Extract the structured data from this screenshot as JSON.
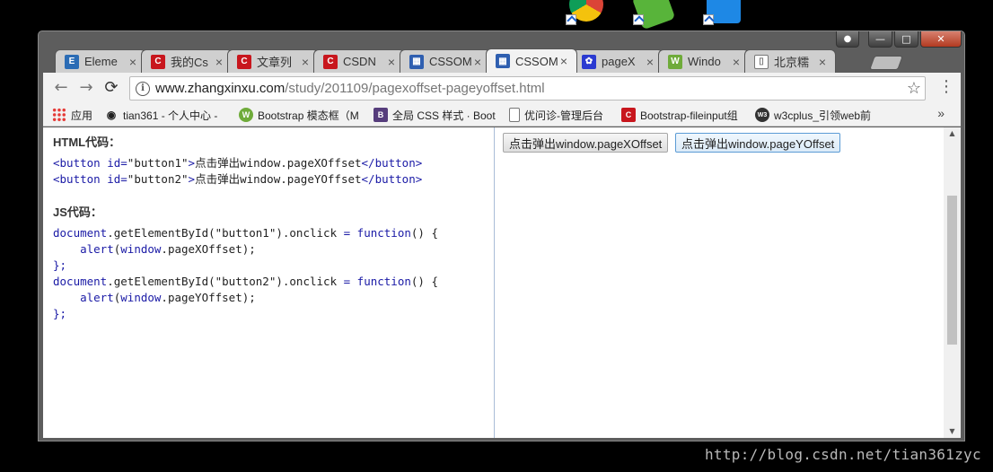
{
  "window": {
    "controls": {
      "minimize": "—",
      "maximize": "□",
      "close": "✕",
      "user": "👤"
    }
  },
  "tabs": [
    {
      "title": "Eleme",
      "favicon": "element-icon",
      "color": "#2b6cb5",
      "glyph": "E"
    },
    {
      "title": "我的Cs",
      "favicon": "csdn-icon",
      "color": "#c8161d",
      "glyph": "C"
    },
    {
      "title": "文章列",
      "favicon": "csdn-icon",
      "color": "#c8161d",
      "glyph": "C"
    },
    {
      "title": "CSDN",
      "favicon": "csdn-icon",
      "color": "#c8161d",
      "glyph": "C"
    },
    {
      "title": "CSSOM",
      "favicon": "zhangxinxu-icon",
      "color": "#2f5fb0",
      "glyph": "▦"
    },
    {
      "title": "CSSOM",
      "favicon": "zhangxinxu-icon",
      "color": "#2f5fb0",
      "glyph": "▦",
      "active": true
    },
    {
      "title": "pageX",
      "favicon": "baidu-paw-icon",
      "color": "#2a3ad1",
      "glyph": "✿"
    },
    {
      "title": "Windo",
      "favicon": "w3school-icon",
      "color": "#6fab3a",
      "glyph": "W"
    },
    {
      "title": "北京糯",
      "favicon": "page-icon",
      "color": "#ffffff",
      "glyph": "▯"
    }
  ],
  "toolbar": {
    "back": "←",
    "forward": "→",
    "reload": "⟳",
    "url_host": "www.zhangxinxu.com",
    "url_path": "/study/201109/pagexoffset-pageyoffset.html",
    "star": "☆",
    "menu": "⋮"
  },
  "bookmarks": [
    {
      "label": "应用",
      "icon": "apps-grid-icon"
    },
    {
      "label": "tian361 - 个人中心 -",
      "icon": "eye-icon"
    },
    {
      "label": "Bootstrap 模态框（M",
      "icon": "w3school-icon"
    },
    {
      "label": "全局 CSS 样式 · Boot",
      "icon": "bootstrap-icon"
    },
    {
      "label": "优问诊-管理后台",
      "icon": "page-icon"
    },
    {
      "label": "Bootstrap-fileinput组",
      "icon": "csdn-icon"
    },
    {
      "label": "w3cplus_引领web前",
      "icon": "w3cplus-icon"
    }
  ],
  "bookmarks_more": "»",
  "page": {
    "html_heading": "HTML代码：",
    "js_heading": "JS代码：",
    "html_code": {
      "line1_open": "<button id=",
      "line1_attr": "\"button1\"",
      "line1_gt": ">",
      "line1_text": "点击弹出window.pageXOffset",
      "line1_close": "</button>",
      "line2_open": "<button id=",
      "line2_attr": "\"button2\"",
      "line2_gt": ">",
      "line2_text": "点击弹出window.pageYOffset",
      "line2_close": "</button>"
    },
    "js_code": {
      "l1_a": "document",
      "l1_b": ".getElementById(\"button1\").onclick ",
      "l1_eq": "=",
      "l1_fn": " function",
      "l1_c": "() {",
      "l2_alert": "    alert",
      "l2_a": "(",
      "l2_win": "window",
      "l2_b": ".pageXOffset);",
      "l3": "};",
      "l4_a": "document",
      "l4_b": ".getElementById(\"button2\").onclick ",
      "l4_eq": "=",
      "l4_fn": " function",
      "l4_c": "() {",
      "l5_alert": "    alert",
      "l5_a": "(",
      "l5_win": "window",
      "l5_b": ".pageYOffset);",
      "l6": "};"
    },
    "button_x": "点击弹出window.pageXOffset",
    "button_y": "点击弹出window.pageYOffset"
  },
  "scrollbar": {
    "up": "▲",
    "down": "▼"
  },
  "watermark": "http://blog.csdn.net/tian361zyc"
}
